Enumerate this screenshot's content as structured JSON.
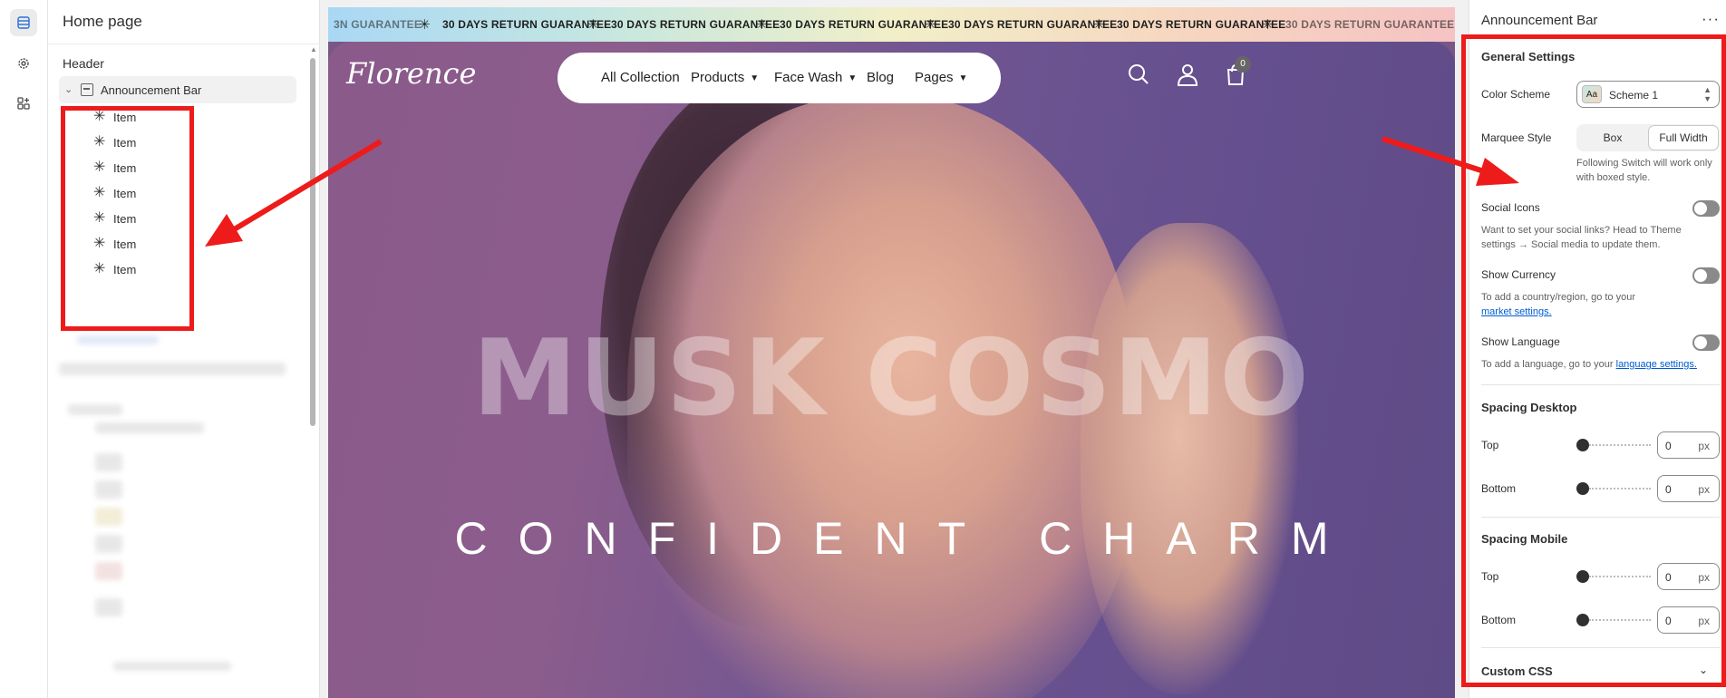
{
  "left_panel": {
    "title": "Home page",
    "group_label": "Header",
    "section_label": "Announcement Bar",
    "items": [
      {
        "label": "Item"
      },
      {
        "label": "Item"
      },
      {
        "label": "Item"
      },
      {
        "label": "Item"
      },
      {
        "label": "Item"
      },
      {
        "label": "Item"
      },
      {
        "label": "Item"
      }
    ]
  },
  "rail": {
    "icons": [
      "sections-icon",
      "settings-gear-icon",
      "apps-icon"
    ]
  },
  "preview": {
    "marquee_partial_left": "3N GUARANTEE",
    "marquee_text": "30 DAYS RETURN GUARANTEE",
    "marquee_partial_right": "30 DAYS RETURN GUARANTEE",
    "logo": "Florence",
    "nav": {
      "all_collection": "All Collection",
      "products": "Products",
      "face_wash": "Face Wash",
      "blog": "Blog",
      "pages": "Pages"
    },
    "cart_count": "0",
    "hero_title": "MUSK COSMO",
    "hero_subtitle": "CONFIDENT CHARM"
  },
  "right_panel": {
    "title": "Announcement Bar",
    "more": "···",
    "general_settings": "General Settings",
    "color_scheme_label": "Color Scheme",
    "color_scheme_swatch": "Aa",
    "color_scheme_value": "Scheme 1",
    "marquee_style_label": "Marquee Style",
    "marquee_options": [
      "Box",
      "Full Width"
    ],
    "marquee_selected": "Full Width",
    "marquee_help": "Following Switch will work only with boxed style.",
    "social_icons_label": "Social Icons",
    "social_icons_help": "Want to set your social links? Head to Theme settings → Social media to update them.",
    "show_currency_label": "Show Currency",
    "show_currency_help": "To add a country/region, go to your",
    "show_currency_link": "market settings.",
    "show_language_label": "Show Language",
    "show_language_help": "To add a language, go to your",
    "show_language_link": "language settings.",
    "spacing_desktop": "Spacing Desktop",
    "spacing_mobile": "Spacing Mobile",
    "top_label": "Top",
    "bottom_label": "Bottom",
    "desktop_top": "0",
    "desktop_bottom": "0",
    "mobile_top": "0",
    "mobile_bottom": "0",
    "unit": "px",
    "custom_css": "Custom CSS"
  },
  "colors": {
    "annotation_red": "#ee1b1b",
    "link_blue": "#005bd3"
  }
}
